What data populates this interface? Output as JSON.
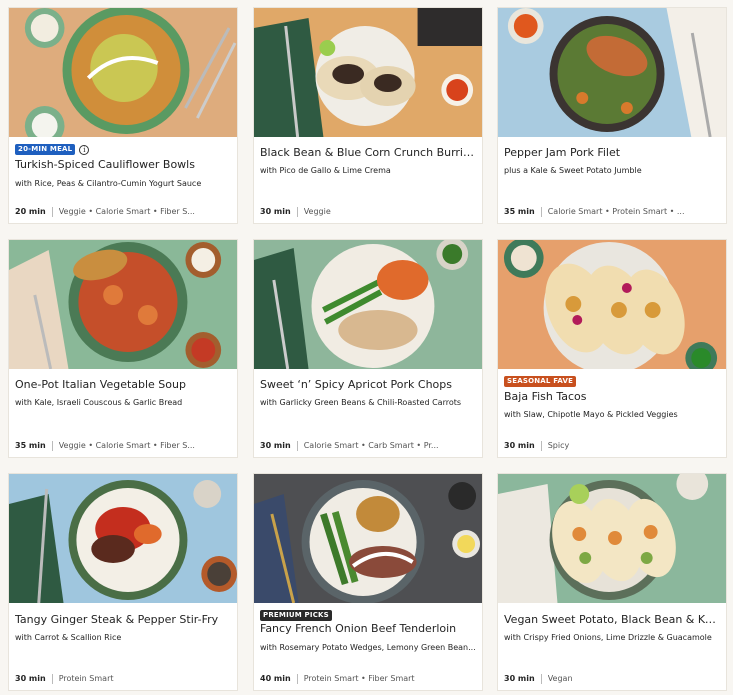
{
  "recipes": [
    {
      "title": "Turkish-Spiced Cauliflower Bowls",
      "subtitle": "with Rice, Peas & Cilantro-Cumin Yogurt Sauce",
      "time": "20 min",
      "tags": "Veggie • Calorie Smart • Fiber S...",
      "badge": "20-MIN MEAL",
      "badge_color": "#1e5fbf",
      "info_icon": "i"
    },
    {
      "title": "Black Bean & Blue Corn Crunch Burritos",
      "subtitle": "with Pico de Gallo & Lime Crema",
      "time": "30 min",
      "tags": "Veggie"
    },
    {
      "title": "Pepper Jam Pork Filet",
      "subtitle": "plus a Kale & Sweet Potato Jumble",
      "time": "35 min",
      "tags": "Calorie Smart • Protein Smart • ..."
    },
    {
      "title": "One-Pot Italian Vegetable Soup",
      "subtitle": "with Kale, Israeli Couscous & Garlic Bread",
      "time": "35 min",
      "tags": "Veggie • Calorie Smart • Fiber S..."
    },
    {
      "title": "Sweet ‘n’ Spicy Apricot Pork Chops",
      "subtitle": "with Garlicky Green Beans & Chili-Roasted Carrots",
      "time": "30 min",
      "tags": "Calorie Smart • Carb Smart • Pr..."
    },
    {
      "title": "Baja Fish Tacos",
      "subtitle": "with Slaw, Chipotle Mayo & Pickled Veggies",
      "time": "30 min",
      "tags": "Spicy",
      "badge": "SEASONAL FAVE",
      "badge_color": "#c8501e"
    },
    {
      "title": "Tangy Ginger Steak & Pepper Stir-Fry",
      "subtitle": "with Carrot & Scallion Rice",
      "time": "30 min",
      "tags": "Protein Smart"
    },
    {
      "title": "Fancy French Onion Beef Tenderloin",
      "subtitle": "with Rosemary Potato Wedges, Lemony Green Bean...",
      "time": "40 min",
      "tags": "Protein Smart • Fiber Smart",
      "badge": "PREMIUM PICKS",
      "badge_color": "#2a2a2a"
    },
    {
      "title": "Vegan Sweet Potato, Black Bean & Kale ...",
      "subtitle": "with Crispy Fried Onions, Lime Drizzle & Guacamole",
      "time": "30 min",
      "tags": "Vegan"
    }
  ]
}
